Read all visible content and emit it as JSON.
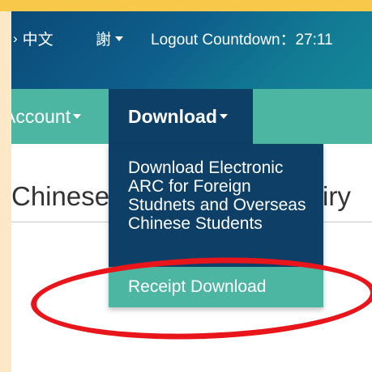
{
  "header": {
    "language_label": "中文",
    "user_name": "謝",
    "logout_countdown": "Logout Countdown：27:11"
  },
  "nav": {
    "account_label": "Account",
    "download_label": "Download"
  },
  "page": {
    "heading_left": "Chinese",
    "heading_right": "iry"
  },
  "dropdown": {
    "items": [
      {
        "label": "Download Electronic ARC for Foreign Studnets and Overseas Chinese Students"
      },
      {
        "label": "Receipt Download"
      }
    ]
  },
  "colors": {
    "header_bg": "#0e5f8c",
    "nav_bg": "#4db6a3",
    "active_menu": "#0d3f67",
    "highlight_ellipse": "#e8161b"
  }
}
